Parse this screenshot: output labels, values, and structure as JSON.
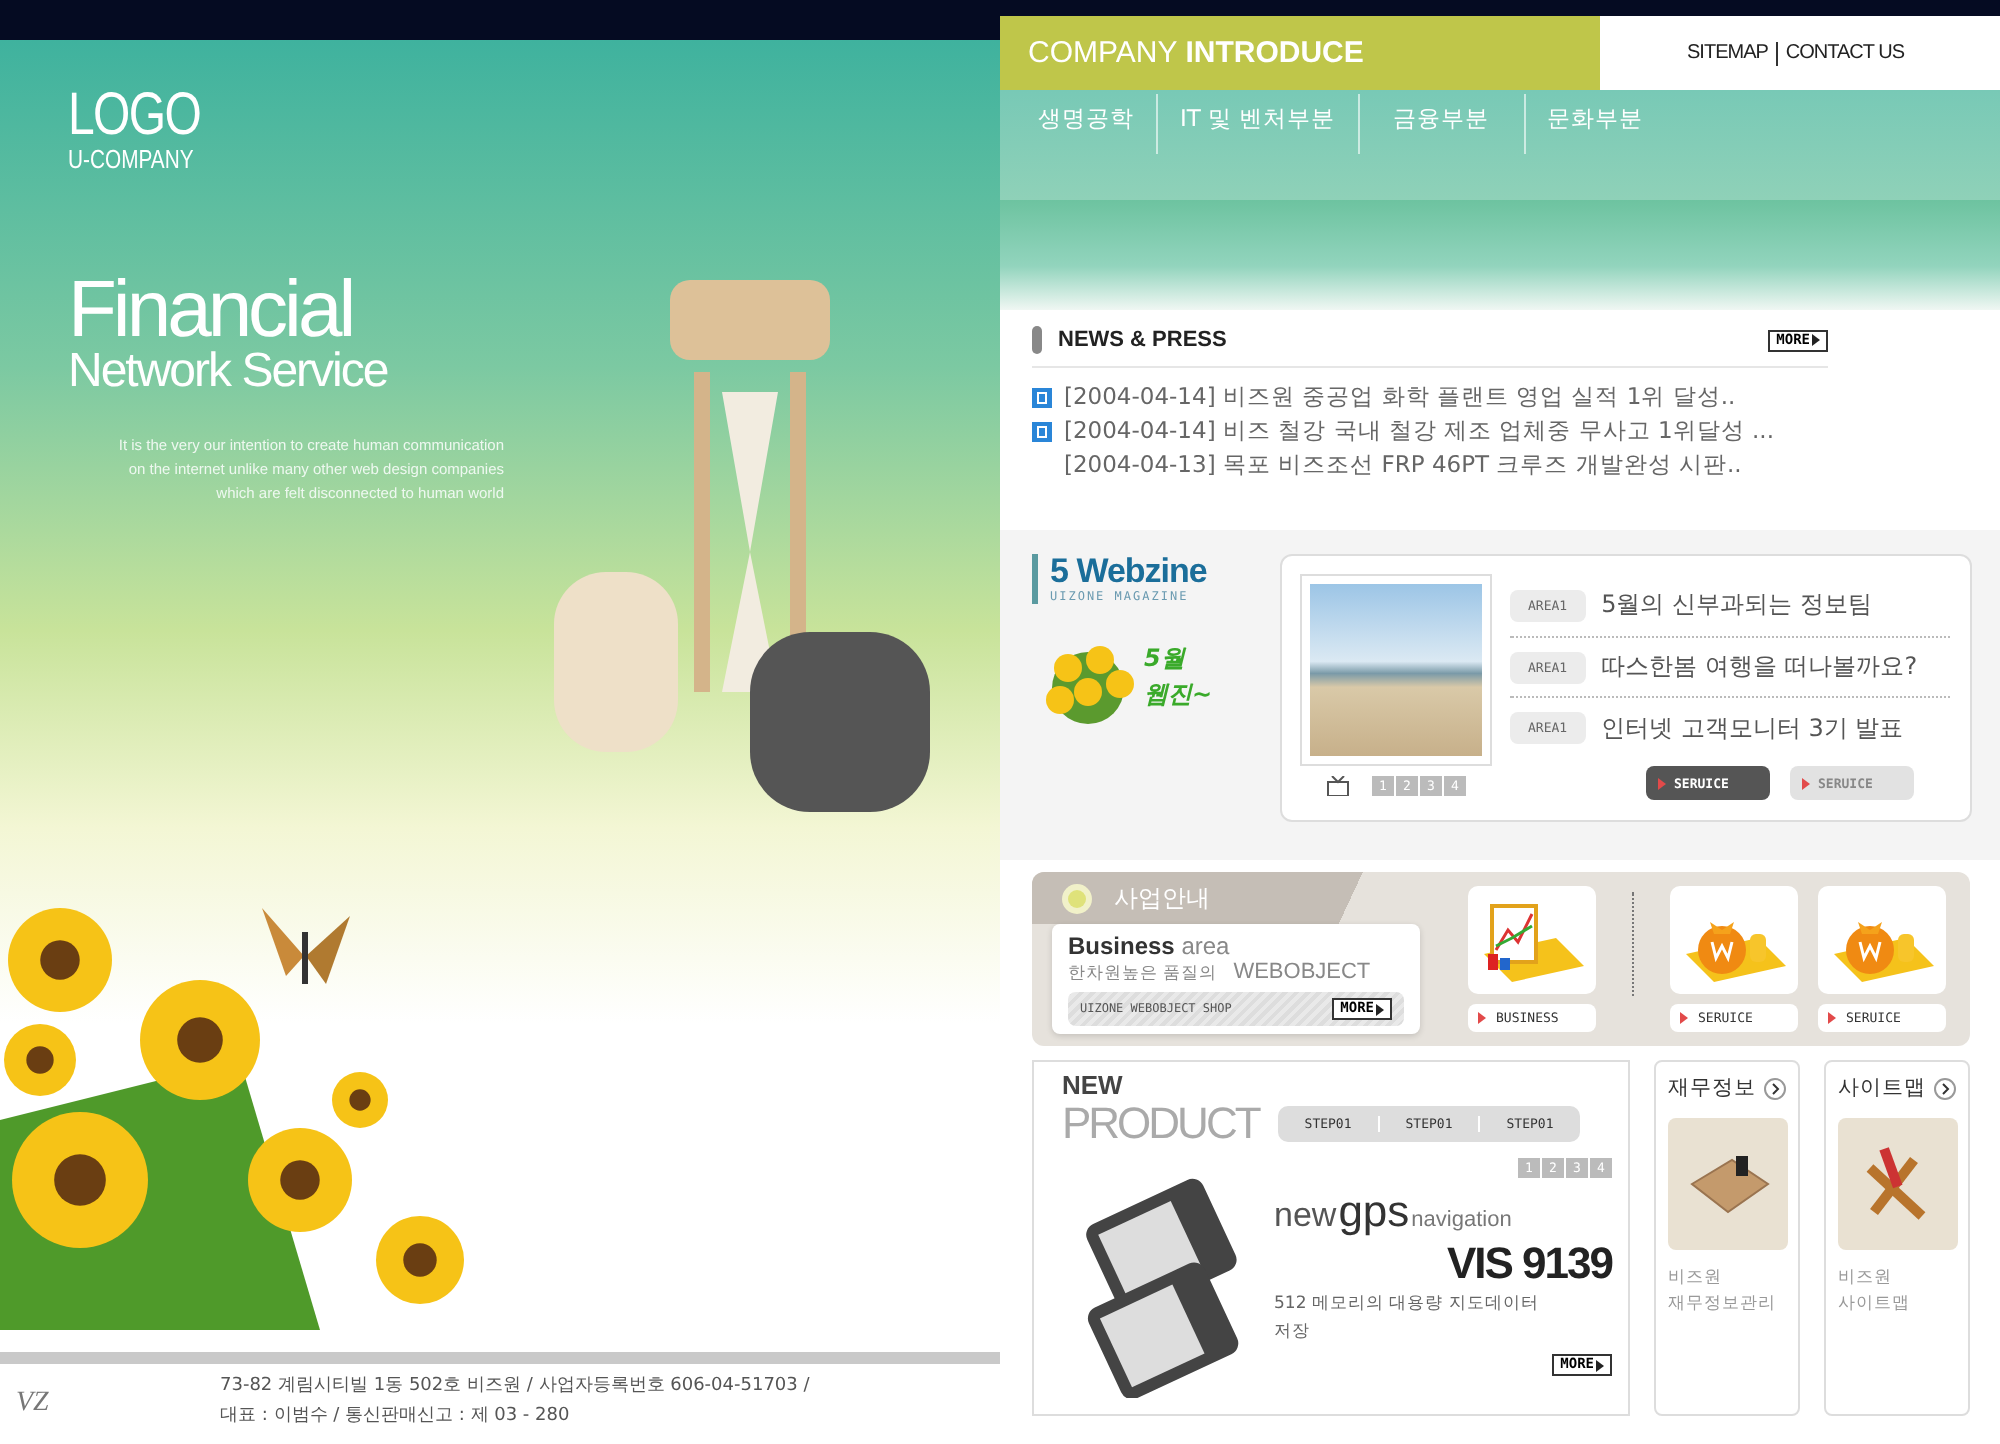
{
  "logo": {
    "title": "LOGO",
    "subtitle": "U-COMPANY"
  },
  "hero": {
    "title": "Financial",
    "subtitle": "Network Service",
    "lines": [
      "It is the very our intention to create human communication",
      "on the internet unlike many other web design companies",
      "which are felt disconnected to human world"
    ]
  },
  "footer": {
    "mark": "VZ",
    "lines": [
      "73-82 계림시티빌 1동 502호 비즈원 / 사업자등록번호 606-04-51703 /",
      "대표 : 이범수 / 통신판매신고 : 제 03 - 280"
    ]
  },
  "header": {
    "title_light": "COMPANY",
    "title_bold": "INTRODUCE",
    "links": [
      "SITEMAP",
      "CONTACT US"
    ]
  },
  "nav": [
    "생명공학",
    "IT 및 벤처부분",
    "금융부분",
    "문화부분"
  ],
  "news": {
    "title": "NEWS & PRESS",
    "more": "MORE",
    "items": [
      {
        "text": "[2004-04-14] 비즈원 중공업 화학 플랜트 영업 실적 1위 달성..",
        "new": true
      },
      {
        "text": "[2004-04-14] 비즈 철강 국내 철강 제조 업체중 무사고 1위달성 ...",
        "new": true
      },
      {
        "text": "[2004-04-13] 목포 비즈조선 FRP 46PT 크루즈 개발완성 시판..",
        "new": false
      }
    ]
  },
  "webzine": {
    "number": "5",
    "title": "Webzine",
    "subtitle": "UIZONE MAGAZINE",
    "badge": [
      "5월",
      "웹진~"
    ],
    "pages": [
      "1",
      "2",
      "3",
      "4"
    ],
    "items": [
      {
        "tag": "AREA1",
        "title": "5월의 신부과되는 정보팀"
      },
      {
        "tag": "AREA1",
        "title": "따스한봄 여행을 떠나볼까요?"
      },
      {
        "tag": "AREA1",
        "title": "인터넷 고객모니터 3기 발표"
      }
    ],
    "buttons": [
      {
        "label": "SERUICE",
        "selected": true
      },
      {
        "label": "SERUICE",
        "selected": false
      }
    ]
  },
  "business": {
    "title": "사업안내",
    "heading_bold": "Business",
    "heading_light": "area",
    "tagline": "한차원높은 품질의",
    "brand": "WEBOBJECT",
    "shop": "UIZONE WEBOBJECT SHOP",
    "more": "MORE",
    "cards": [
      {
        "label": "BUSINESS",
        "kind": "chart"
      },
      {
        "label": "SERUICE",
        "kind": "money"
      },
      {
        "label": "SERUICE",
        "kind": "money"
      }
    ]
  },
  "product": {
    "new": "NEW",
    "title": "PRODUCT",
    "steps": [
      "STEP01",
      "STEP01",
      "STEP01"
    ],
    "pages": [
      "1",
      "2",
      "3",
      "4"
    ],
    "brand_light": "new",
    "brand_bold": "gps",
    "brand_tail": "navigation",
    "model": "VIS 9139",
    "description": "512 메모리의 대용량 지도데이터 저장",
    "more": "MORE"
  },
  "side_boxes": [
    {
      "title": "재무정보",
      "kind": "notebook",
      "lines": [
        "비즈원",
        "재무정보관리"
      ]
    },
    {
      "title": "사이트맵",
      "kind": "tools",
      "lines": [
        "비즈원",
        "사이트맵"
      ]
    }
  ]
}
